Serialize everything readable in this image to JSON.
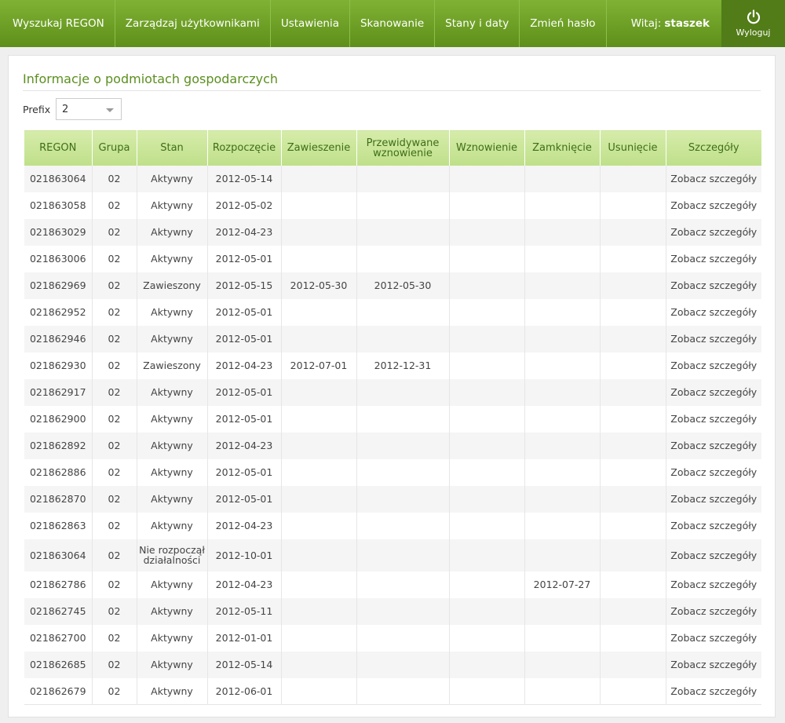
{
  "nav": {
    "items": [
      "Wyszukaj REGON",
      "Zarządzaj użytkownikami",
      "Ustawienia",
      "Skanowanie",
      "Stany i daty",
      "Zmień hasło"
    ],
    "welcome_label": "Witaj:",
    "username": "staszek",
    "logout_label": "Wyloguj"
  },
  "page": {
    "title": "Informacje o podmiotach gospodarczych",
    "prefix_label": "Prefix",
    "prefix_value": "2"
  },
  "table": {
    "headers": [
      "REGON",
      "Grupa",
      "Stan",
      "Rozpoczęcie",
      "Zawieszenie",
      "Przewidywane wznowienie",
      "Wznowienie",
      "Zamknięcie",
      "Usunięcie",
      "Szczegóły"
    ],
    "rows": [
      [
        "021863064",
        "02",
        "Aktywny",
        "2012-05-14",
        "",
        "",
        "",
        "",
        "",
        "Zobacz szczegóły"
      ],
      [
        "021863058",
        "02",
        "Aktywny",
        "2012-05-02",
        "",
        "",
        "",
        "",
        "",
        "Zobacz szczegóły"
      ],
      [
        "021863029",
        "02",
        "Aktywny",
        "2012-04-23",
        "",
        "",
        "",
        "",
        "",
        "Zobacz szczegóły"
      ],
      [
        "021863006",
        "02",
        "Aktywny",
        "2012-05-01",
        "",
        "",
        "",
        "",
        "",
        "Zobacz szczegóły"
      ],
      [
        "021862969",
        "02",
        "Zawieszony",
        "2012-05-15",
        "2012-05-30",
        "2012-05-30",
        "",
        "",
        "",
        "Zobacz szczegóły"
      ],
      [
        "021862952",
        "02",
        "Aktywny",
        "2012-05-01",
        "",
        "",
        "",
        "",
        "",
        "Zobacz szczegóły"
      ],
      [
        "021862946",
        "02",
        "Aktywny",
        "2012-05-01",
        "",
        "",
        "",
        "",
        "",
        "Zobacz szczegóły"
      ],
      [
        "021862930",
        "02",
        "Zawieszony",
        "2012-04-23",
        "2012-07-01",
        "2012-12-31",
        "",
        "",
        "",
        "Zobacz szczegóły"
      ],
      [
        "021862917",
        "02",
        "Aktywny",
        "2012-05-01",
        "",
        "",
        "",
        "",
        "",
        "Zobacz szczegóły"
      ],
      [
        "021862900",
        "02",
        "Aktywny",
        "2012-05-01",
        "",
        "",
        "",
        "",
        "",
        "Zobacz szczegóły"
      ],
      [
        "021862892",
        "02",
        "Aktywny",
        "2012-04-23",
        "",
        "",
        "",
        "",
        "",
        "Zobacz szczegóły"
      ],
      [
        "021862886",
        "02",
        "Aktywny",
        "2012-05-01",
        "",
        "",
        "",
        "",
        "",
        "Zobacz szczegóły"
      ],
      [
        "021862870",
        "02",
        "Aktywny",
        "2012-05-01",
        "",
        "",
        "",
        "",
        "",
        "Zobacz szczegóły"
      ],
      [
        "021862863",
        "02",
        "Aktywny",
        "2012-04-23",
        "",
        "",
        "",
        "",
        "",
        "Zobacz szczegóły"
      ],
      [
        "021863064",
        "02",
        "Nie rozpoczął działalności",
        "2012-10-01",
        "",
        "",
        "",
        "",
        "",
        "Zobacz szczegóły"
      ],
      [
        "021862786",
        "02",
        "Aktywny",
        "2012-04-23",
        "",
        "",
        "",
        "2012-07-27",
        "",
        "Zobacz szczegóły"
      ],
      [
        "021862745",
        "02",
        "Aktywny",
        "2012-05-11",
        "",
        "",
        "",
        "",
        "",
        "Zobacz szczegóły"
      ],
      [
        "021862700",
        "02",
        "Aktywny",
        "2012-01-01",
        "",
        "",
        "",
        "",
        "",
        "Zobacz szczegóły"
      ],
      [
        "021862685",
        "02",
        "Aktywny",
        "2012-05-14",
        "",
        "",
        "",
        "",
        "",
        "Zobacz szczegóły"
      ],
      [
        "021862679",
        "02",
        "Aktywny",
        "2012-06-01",
        "",
        "",
        "",
        "",
        "",
        "Zobacz szczegóły"
      ]
    ]
  }
}
